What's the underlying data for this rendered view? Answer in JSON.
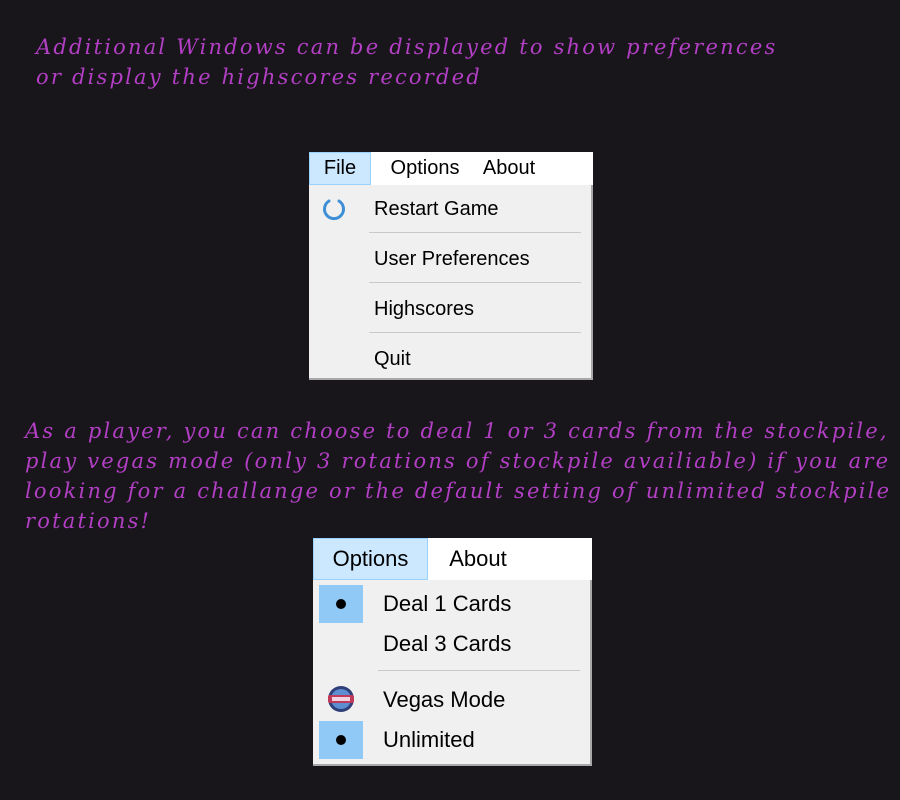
{
  "caption_top": {
    "line1": "Additional Windows can be displayed to show preferences",
    "line2": "or display the highscores recorded"
  },
  "menu_file": {
    "menubar": [
      "File",
      "Options",
      "About"
    ],
    "items": [
      {
        "label": "Restart Game",
        "icon": "restart-icon"
      },
      {
        "label": "User Preferences"
      },
      {
        "label": "Highscores"
      },
      {
        "label": "Quit"
      }
    ]
  },
  "caption_bottom": {
    "line1": "As a player, you can choose to deal 1 or 3 cards from the stockpile,",
    "line2": "play vegas mode (only 3 rotations of stockpile availiable) if you are",
    "line3": "looking for a challange or the default setting of unlimited stockpile",
    "line4": "rotations!"
  },
  "menu_options": {
    "menubar": [
      "Options",
      "About"
    ],
    "items": [
      {
        "label": "Deal 1 Cards",
        "checked": true
      },
      {
        "label": "Deal 3 Cards",
        "checked": false
      },
      {
        "label": "Vegas Mode",
        "icon": "vegas-icon"
      },
      {
        "label": "Unlimited",
        "checked": true
      }
    ]
  },
  "colors": {
    "background": "#18151b",
    "caption": "#b23fc4",
    "menu_highlight": "#cce8ff",
    "radio_highlight": "#90c8f6"
  }
}
